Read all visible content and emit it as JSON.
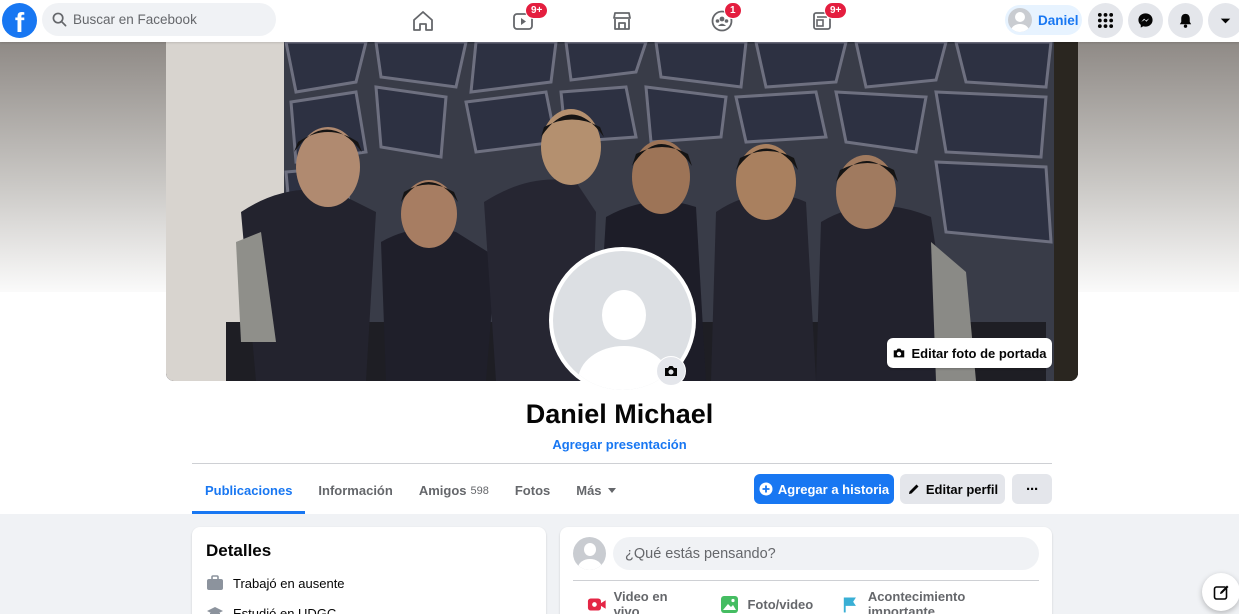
{
  "colors": {
    "accent": "#1877f2",
    "badge": "#e41e3f",
    "page_bg": "#f0f2f5",
    "muted": "#65676b"
  },
  "topbar": {
    "logo_icon": "facebook-logo",
    "search": {
      "placeholder": "Buscar en Facebook",
      "icon": "search-icon"
    },
    "nav": [
      {
        "name": "home",
        "icon": "home-icon",
        "badge": ""
      },
      {
        "name": "watch",
        "icon": "video-icon",
        "badge": "9+"
      },
      {
        "name": "marketplace",
        "icon": "store-icon",
        "badge": ""
      },
      {
        "name": "groups",
        "icon": "groups-icon",
        "badge": "1"
      },
      {
        "name": "gaming",
        "icon": "gaming-icon",
        "badge": "9+"
      }
    ],
    "user": {
      "name": "Daniel",
      "icon": "avatar"
    },
    "right_buttons": [
      "menu-grid-icon",
      "messenger-icon",
      "notifications-bell-icon",
      "account-caret-icon"
    ]
  },
  "profile": {
    "edit_cover_label": "Editar foto de portada",
    "name": "Daniel Michael",
    "intro_link": "Agregar presentación"
  },
  "tabs": [
    {
      "label": "Publicaciones",
      "count": "",
      "active": true
    },
    {
      "label": "Información",
      "count": ""
    },
    {
      "label": "Amigos",
      "count": "598"
    },
    {
      "label": "Fotos",
      "count": ""
    },
    {
      "label": "Más",
      "count": ""
    }
  ],
  "actions": {
    "add_story": "Agregar a historia",
    "edit_profile": "Editar perfil",
    "more": "···"
  },
  "details": {
    "title": "Detalles",
    "items": [
      {
        "icon": "briefcase-icon",
        "text": "Trabajó en ausente"
      },
      {
        "icon": "graduation-cap-icon",
        "text": "Estudió en UDGC"
      }
    ]
  },
  "composer": {
    "prompt": "¿Qué estás pensando?",
    "actions": [
      {
        "icon": "live-video-icon",
        "label": "Video en vivo"
      },
      {
        "icon": "photo-video-icon",
        "label": "Foto/video"
      },
      {
        "icon": "flag-icon",
        "label": "Acontecimiento importante"
      }
    ]
  }
}
